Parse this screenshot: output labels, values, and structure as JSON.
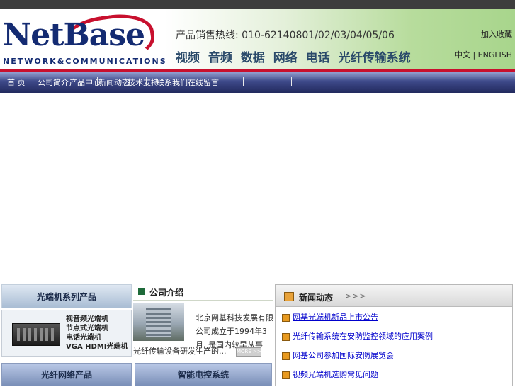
{
  "header": {
    "logo_text": "NetBase",
    "logo_sub": "NETWORK&COMMUNICATIONS",
    "hotline": "产品销售热线: 010-62140801/02/03/04/05/06",
    "tagline": "视频 音频 数据 网络 电话 光纤传输系统",
    "top_link": "加入收藏",
    "lang_cn": "中文",
    "lang_sep": "|",
    "lang_en": "ENGLISH"
  },
  "nav": {
    "items": [
      "首 页",
      "公司简介",
      "产品中心",
      "新闻动态",
      "技术支持",
      "联系我们",
      "在线留言"
    ]
  },
  "side": {
    "heading": "光端机系列产品",
    "products": [
      "视音频光端机",
      "节点式光端机",
      "电话光端机",
      "VGA HDMI光端机"
    ]
  },
  "about": {
    "title": "公司介绍",
    "text": "北京网基科技发展有限公司成立于1994年3月, 是国内较早从事",
    "more_text": "光纤传输设备研发生产的...",
    "more_btn": "MORE >>"
  },
  "news": {
    "title": "新闻动态",
    "arrows": ">>>",
    "items": [
      "网基光端机新品上市公告",
      "光纤传输系统在安防监控领域的应用案例",
      "网基公司参加国际安防展览会",
      "视频光端机选购常见问题"
    ]
  },
  "bottom": {
    "tab1": "光纤网络产品",
    "tab2": "智能电控系统"
  },
  "colors": {
    "nav_top": "#9aa6d6",
    "nav_bottom": "#222a5e",
    "accent_red": "#c8102e",
    "link": "#0000cc"
  }
}
